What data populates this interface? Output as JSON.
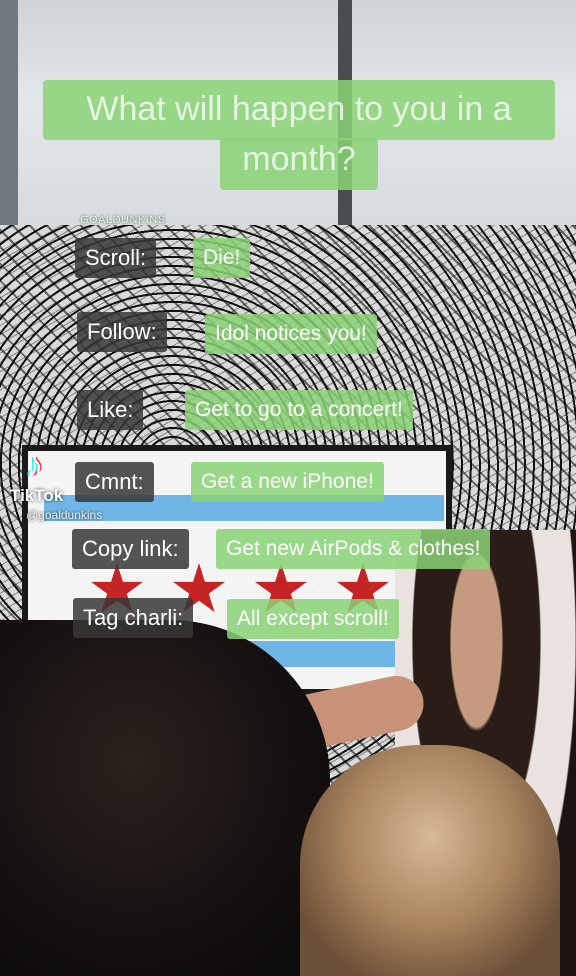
{
  "title": "What will happen to you in a month?",
  "mini_handle": "GOALDUNKINS",
  "watermark": {
    "logo_icon": "tiktok-logo-icon",
    "brand": "TikTok",
    "handle": "@goaldunkins"
  },
  "rows": [
    {
      "label": "Scroll:",
      "result": "Die!"
    },
    {
      "label": "Follow:",
      "result": "Idol notices you!"
    },
    {
      "label": "Like:",
      "result": "Get to go to a concert!"
    },
    {
      "label": "Cmnt:",
      "result": "Get a new iPhone!"
    },
    {
      "label": "Copy link:",
      "result": "Get new AirPods & clothes!"
    },
    {
      "label": "Tag charli:",
      "result": "All except scroll!"
    }
  ],
  "colors": {
    "label_bg": "#373737",
    "result_bg": "#8AD276",
    "text": "#FFFFFF"
  }
}
